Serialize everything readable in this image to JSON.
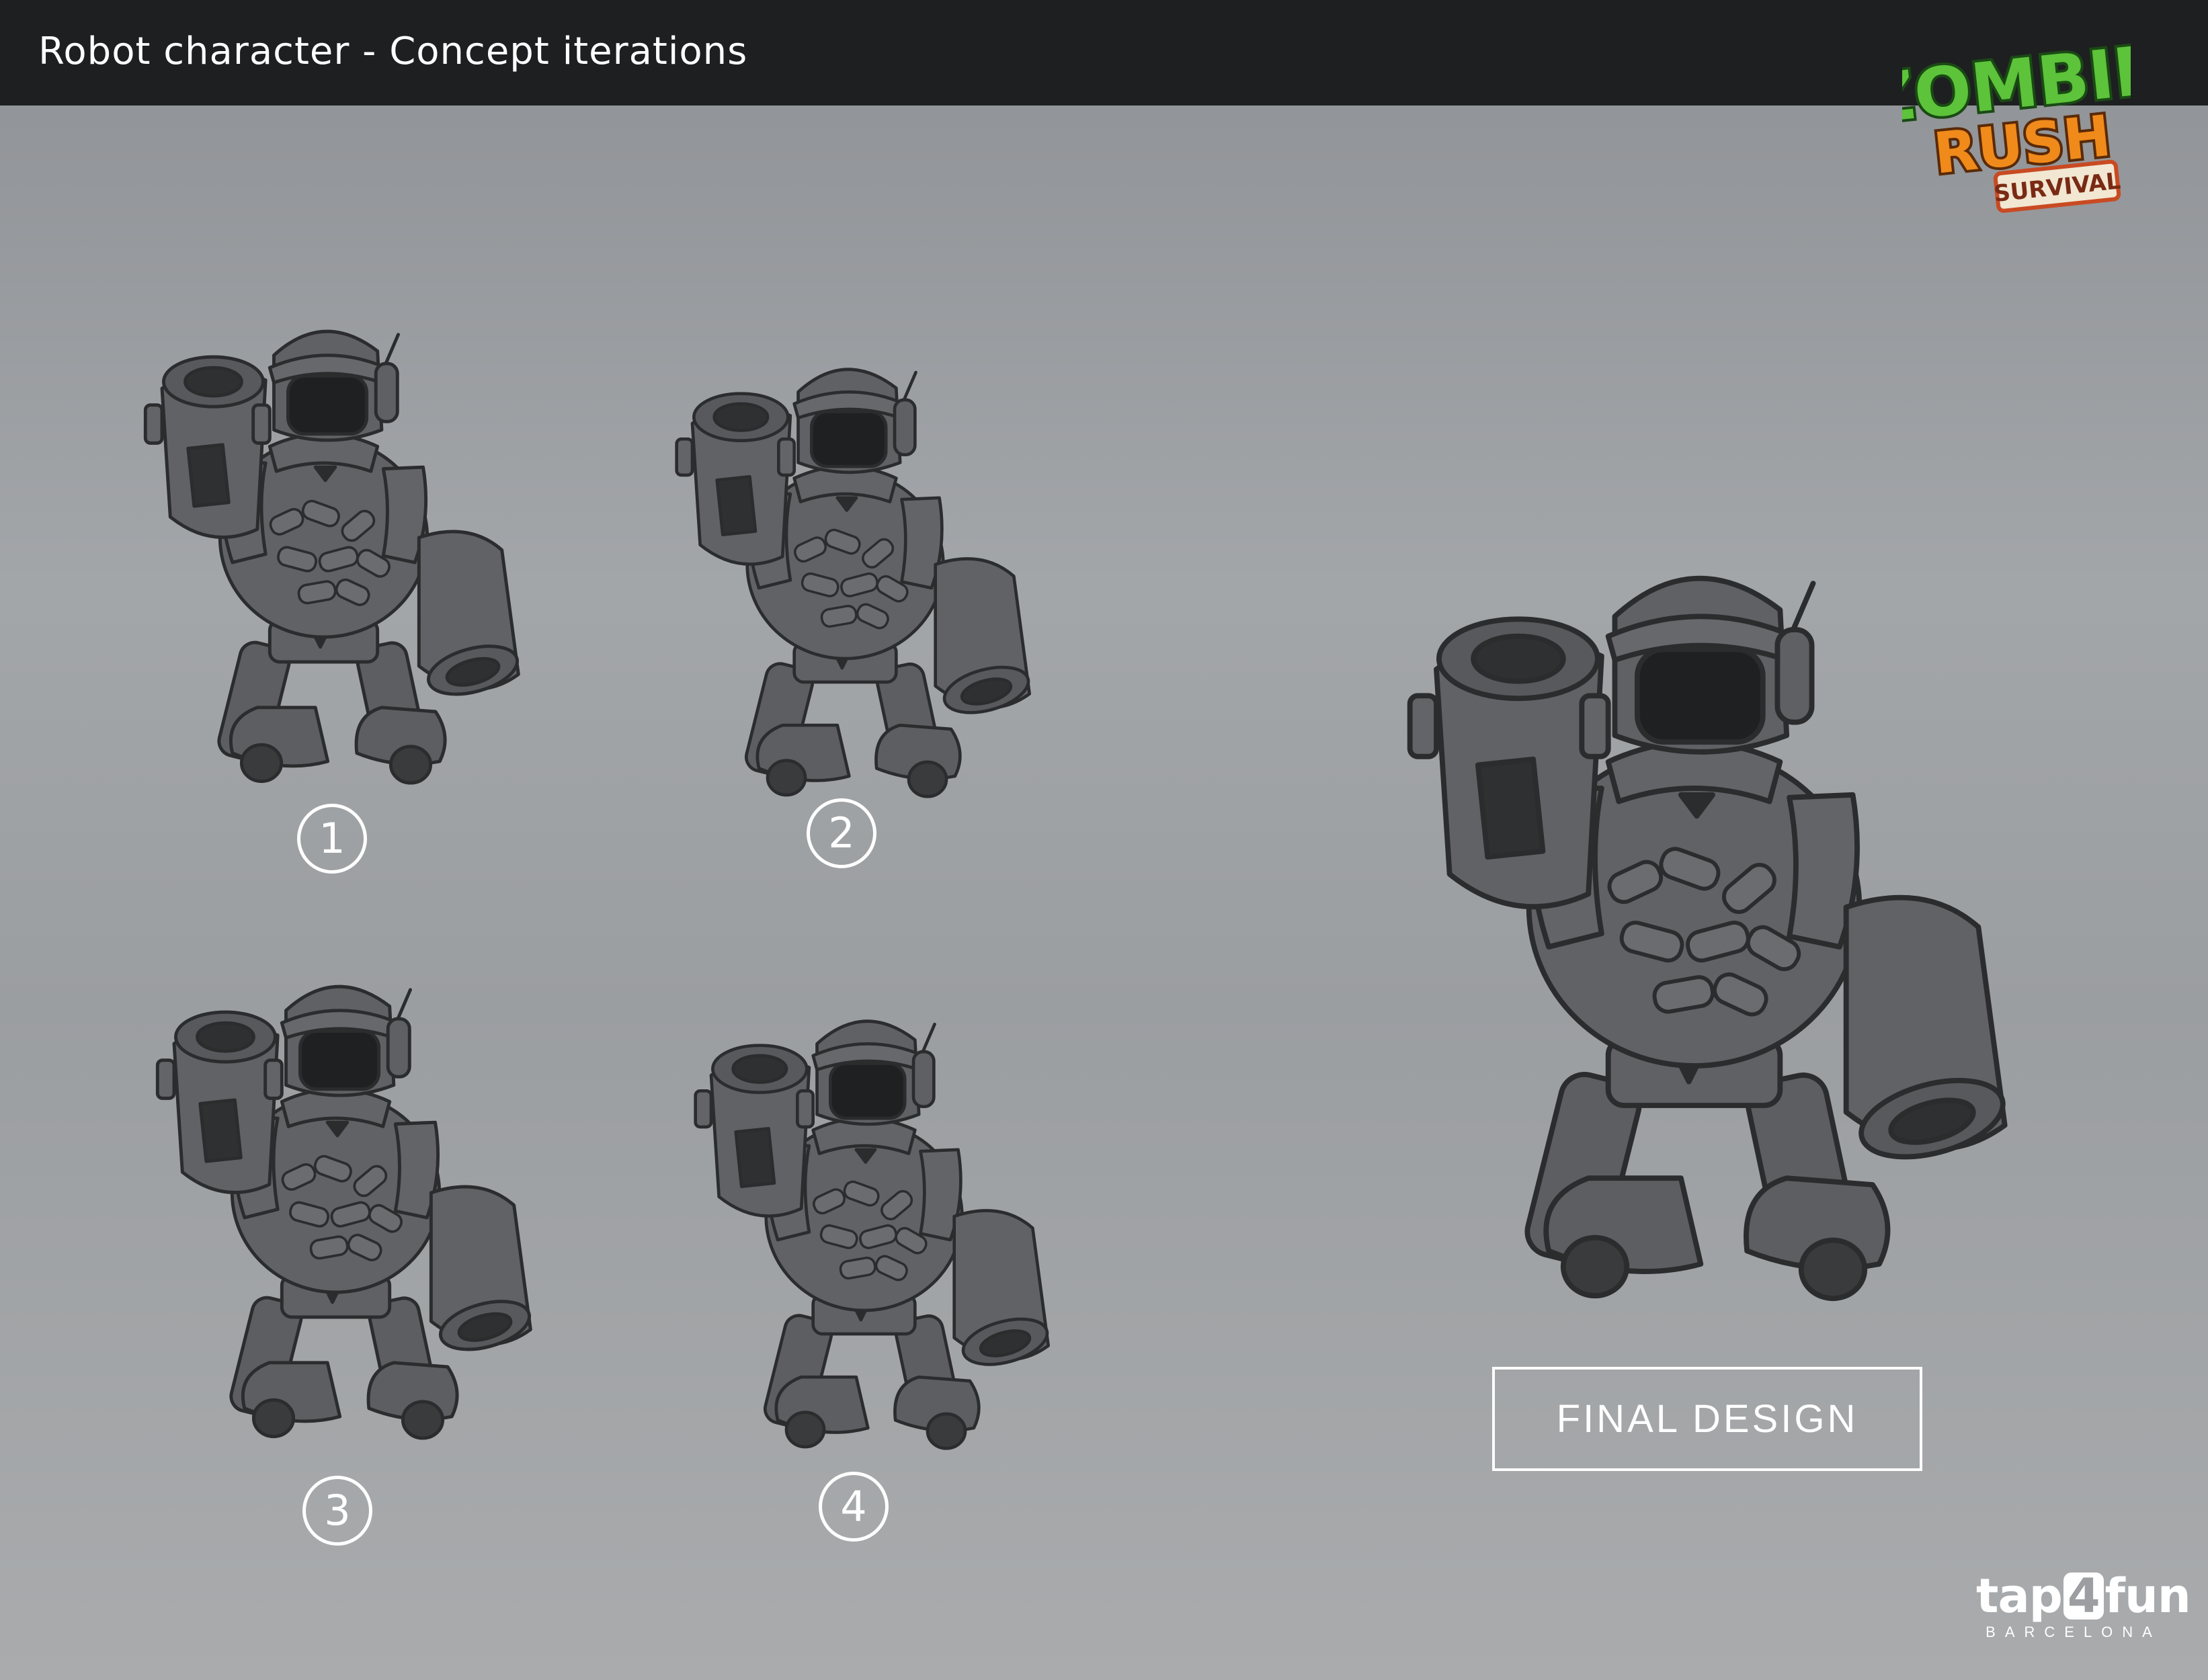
{
  "header": {
    "title": "Robot character - Concept iterations"
  },
  "logo": {
    "line1": "ZOMBIE",
    "line2": "RUSH",
    "badge": "SURVIVAL"
  },
  "iterations": [
    {
      "number": "1"
    },
    {
      "number": "2"
    },
    {
      "number": "3"
    },
    {
      "number": "4"
    }
  ],
  "final_label": "FINAL DESIGN",
  "brand": {
    "main_prefix": "tap",
    "main_digit": "4",
    "main_suffix": "fun",
    "sub": "BARCELONA"
  },
  "colors": {
    "header_bg": "#1e1f21",
    "sketch_fill": "#5e6063",
    "sketch_line": "#2b2c2e",
    "logo_green": "#5cc33a",
    "logo_orange": "#f08a1a",
    "logo_badge": "#c94a22"
  }
}
